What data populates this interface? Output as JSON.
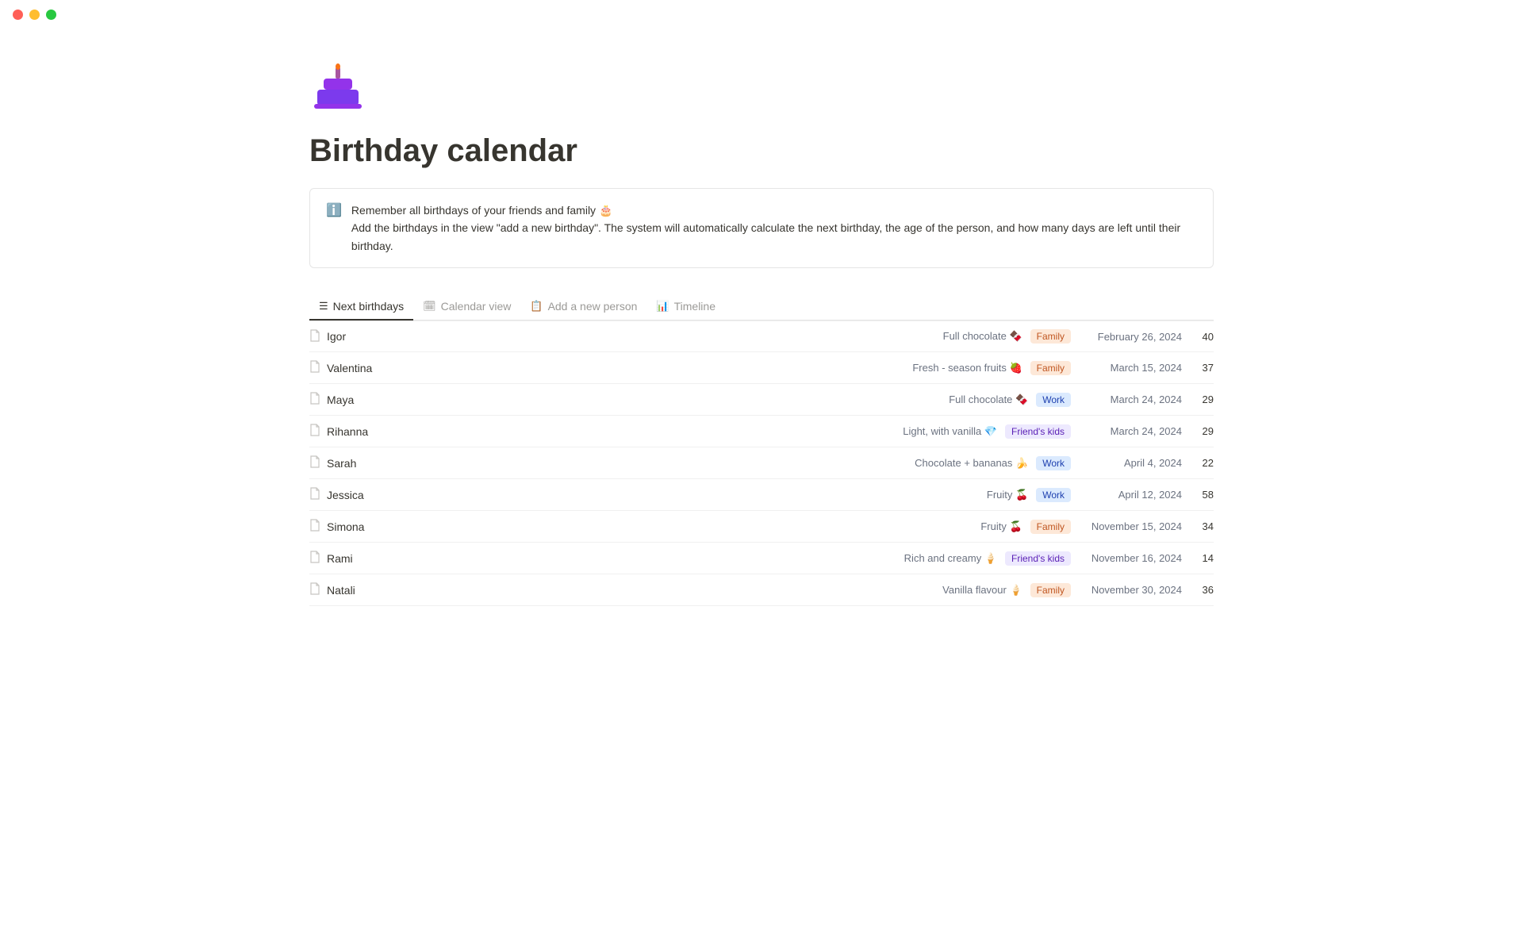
{
  "titlebar": {
    "close_label": "",
    "min_label": "",
    "max_label": ""
  },
  "page": {
    "icon": "🎂",
    "title": "Birthday calendar",
    "info_icon": "ℹ️",
    "info_line1": "Remember all birthdays of your friends and family 🎂",
    "info_line2": "Add the birthdays in the view \"add a new birthday\". The system will automatically calculate the next birthday, the age of the person, and how many days are left until their birthday."
  },
  "tabs": [
    {
      "id": "next-birthdays",
      "icon": "☰",
      "label": "Next birthdays",
      "active": true
    },
    {
      "id": "calendar-view",
      "icon": "📅",
      "label": "Calendar view",
      "active": false
    },
    {
      "id": "add-new-person",
      "icon": "📋",
      "label": "Add a new person",
      "active": false
    },
    {
      "id": "timeline",
      "icon": "📊",
      "label": "Timeline",
      "active": false
    }
  ],
  "rows": [
    {
      "name": "Igor",
      "flavor": "Full chocolate 🍫",
      "tag": "Family",
      "tag_type": "family",
      "date": "February 26, 2024",
      "age": "40"
    },
    {
      "name": "Valentina",
      "flavor": "Fresh - season fruits 🍓",
      "tag": "Family",
      "tag_type": "family",
      "date": "March 15, 2024",
      "age": "37"
    },
    {
      "name": "Maya",
      "flavor": "Full chocolate 🍫",
      "tag": "Work",
      "tag_type": "work",
      "date": "March 24, 2024",
      "age": "29"
    },
    {
      "name": "Rihanna",
      "flavor": "Light, with vanilla 💎",
      "tag": "Friend's kids",
      "tag_type": "friends-kids",
      "date": "March 24, 2024",
      "age": "29"
    },
    {
      "name": "Sarah",
      "flavor": "Chocolate + bananas 🍌",
      "tag": "Work",
      "tag_type": "work",
      "date": "April 4, 2024",
      "age": "22"
    },
    {
      "name": "Jessica",
      "flavor": "Fruity 🍒",
      "tag": "Work",
      "tag_type": "work",
      "date": "April 12, 2024",
      "age": "58"
    },
    {
      "name": "Simona",
      "flavor": "Fruity 🍒",
      "tag": "Family",
      "tag_type": "family",
      "date": "November 15, 2024",
      "age": "34"
    },
    {
      "name": "Rami",
      "flavor": "Rich and creamy 🍦",
      "tag": "Friend's kids",
      "tag_type": "friends-kids",
      "date": "November 16, 2024",
      "age": "14"
    },
    {
      "name": "Natali",
      "flavor": "Vanilla flavour 🍦",
      "tag": "Family",
      "tag_type": "family",
      "date": "November 30, 2024",
      "age": "36"
    }
  ]
}
